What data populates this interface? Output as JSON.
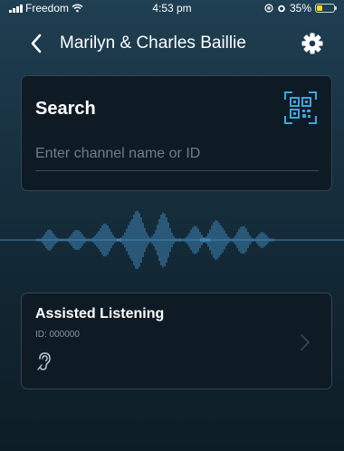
{
  "status_bar": {
    "carrier": "Freedom",
    "time": "4:53 pm",
    "battery_percent": "35%",
    "battery_level": 0.35,
    "battery_color": "#f5d90a"
  },
  "nav": {
    "title": "Marilyn & Charles Baillie",
    "back_icon": "chevron-left-icon",
    "settings_icon": "gear-icon"
  },
  "search": {
    "title": "Search",
    "placeholder": "Enter channel name or ID",
    "value": "",
    "scan_icon": "qr-code-scan-icon",
    "accent_color": "#3aa6e0"
  },
  "waveform": {
    "color": "#3f86b8"
  },
  "channel": {
    "name": "Assisted Listening",
    "id_text": "ID: 000000",
    "icon": "ear-icon",
    "arrow_icon": "chevron-right-icon"
  }
}
